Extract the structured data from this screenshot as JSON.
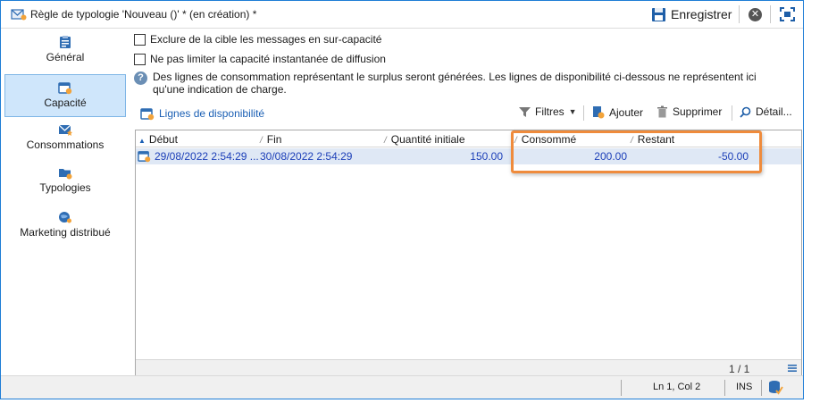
{
  "window": {
    "title": "Règle de typologie 'Nouveau ()' * (en création) *"
  },
  "toolbar": {
    "save_label": "Enregistrer"
  },
  "sidebar": {
    "items": [
      {
        "label": "Général",
        "icon": "clipboard-icon",
        "active": false
      },
      {
        "label": "Capacité",
        "icon": "calendar-gear-icon",
        "active": true
      },
      {
        "label": "Consommations",
        "icon": "envelope-star-icon",
        "active": false
      },
      {
        "label": "Typologies",
        "icon": "folder-gear-icon",
        "active": false
      },
      {
        "label": "Marketing distribué",
        "icon": "globe-user-icon",
        "active": false
      }
    ]
  },
  "options": {
    "exclude_overcapacity": {
      "label": "Exclure de la cible les messages en sur-capacité",
      "checked": false
    },
    "no_instant_limit": {
      "label": "Ne pas limiter la capacité instantanée de diffusion",
      "checked": false
    }
  },
  "info": {
    "text_line1": "Des lignes de consommation représentant le surplus seront générées. Les lignes de disponibilité ci-dessous ne représentent ici",
    "text_line2": "qu'une indication de charge."
  },
  "list": {
    "title": "Lignes de disponibilité",
    "filters_label": "Filtres",
    "add_label": "Ajouter",
    "delete_label": "Supprimer",
    "detail_label": "Détail..."
  },
  "table": {
    "columns": [
      "Début",
      "Fin",
      "Quantité initiale",
      "Consommé",
      "Restant"
    ],
    "rows": [
      {
        "start": "29/08/2022 2:54:29 ...",
        "end": "30/08/2022 2:54:29",
        "initial": "150.00",
        "consumed": "200.00",
        "remaining": "-50.00"
      }
    ],
    "pager": "1 / 1"
  },
  "status": {
    "position": "Ln 1, Col 2",
    "mode": "INS"
  },
  "colors": {
    "accent": "#1a5fb4",
    "highlight": "#ef8b3c",
    "row_selected": "#dfe8f5",
    "active_nav": "#cfe6fb"
  }
}
